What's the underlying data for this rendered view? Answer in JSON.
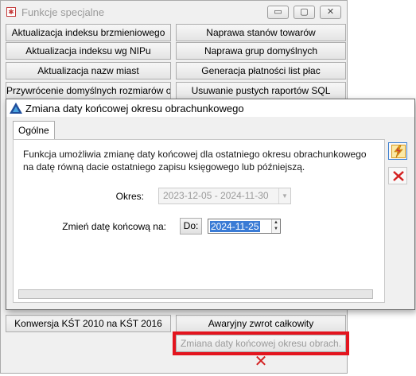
{
  "background_window": {
    "title": "Funkcje specjalne",
    "controls": {
      "minimize": "▭",
      "maximize": "▢",
      "close": "✕"
    },
    "buttons": [
      {
        "label": "Aktualizacja indeksu brzmieniowego",
        "enabled": true
      },
      {
        "label": "Naprawa stanów towarów",
        "enabled": true
      },
      {
        "label": "Aktualizacja indeksu wg NIPu",
        "enabled": true
      },
      {
        "label": "Naprawa grup domyślnych",
        "enabled": true
      },
      {
        "label": "Aktualizacja nazw miast",
        "enabled": true
      },
      {
        "label": "Generacja płatności list płac",
        "enabled": true
      },
      {
        "label": "Przywrócenie domyślnych rozmiarów okien",
        "enabled": true
      },
      {
        "label": "Usuwanie pustych raportów SQL",
        "enabled": true
      },
      {
        "label": "Konwersja KŚT 2010 na KŚT 2016",
        "enabled": true
      },
      {
        "label": "Awaryjny zwrot całkowity",
        "enabled": true
      },
      {
        "label": "Zmiana daty końcowej okresu obrach.",
        "enabled": false,
        "highlighted": true
      }
    ],
    "close_icon": "red-x-icon"
  },
  "dialog": {
    "title": "Zmiana daty końcowej okresu obrachunkowego",
    "tab": "Ogólne",
    "description": "Funkcja umożliwia zmianę daty końcowej dla ostatniego okresu obrachunkowego na datę równą dacie ostatniego zapisu księgowego lub późniejszą.",
    "okres_label": "Okres:",
    "okres_value": "2023-12-05 - 2024-11-30",
    "zmien_label": "Zmień datę końcową na:",
    "do_button": "Do:",
    "date_value": "2024-11-25",
    "progress": 0,
    "side_buttons": {
      "run_icon": "lightning-run-icon",
      "cancel_icon": "cancel-x-icon"
    },
    "colors": {
      "highlight": "#e3141e",
      "selection": "#3a7bd5",
      "close_red": "#d32121"
    }
  }
}
